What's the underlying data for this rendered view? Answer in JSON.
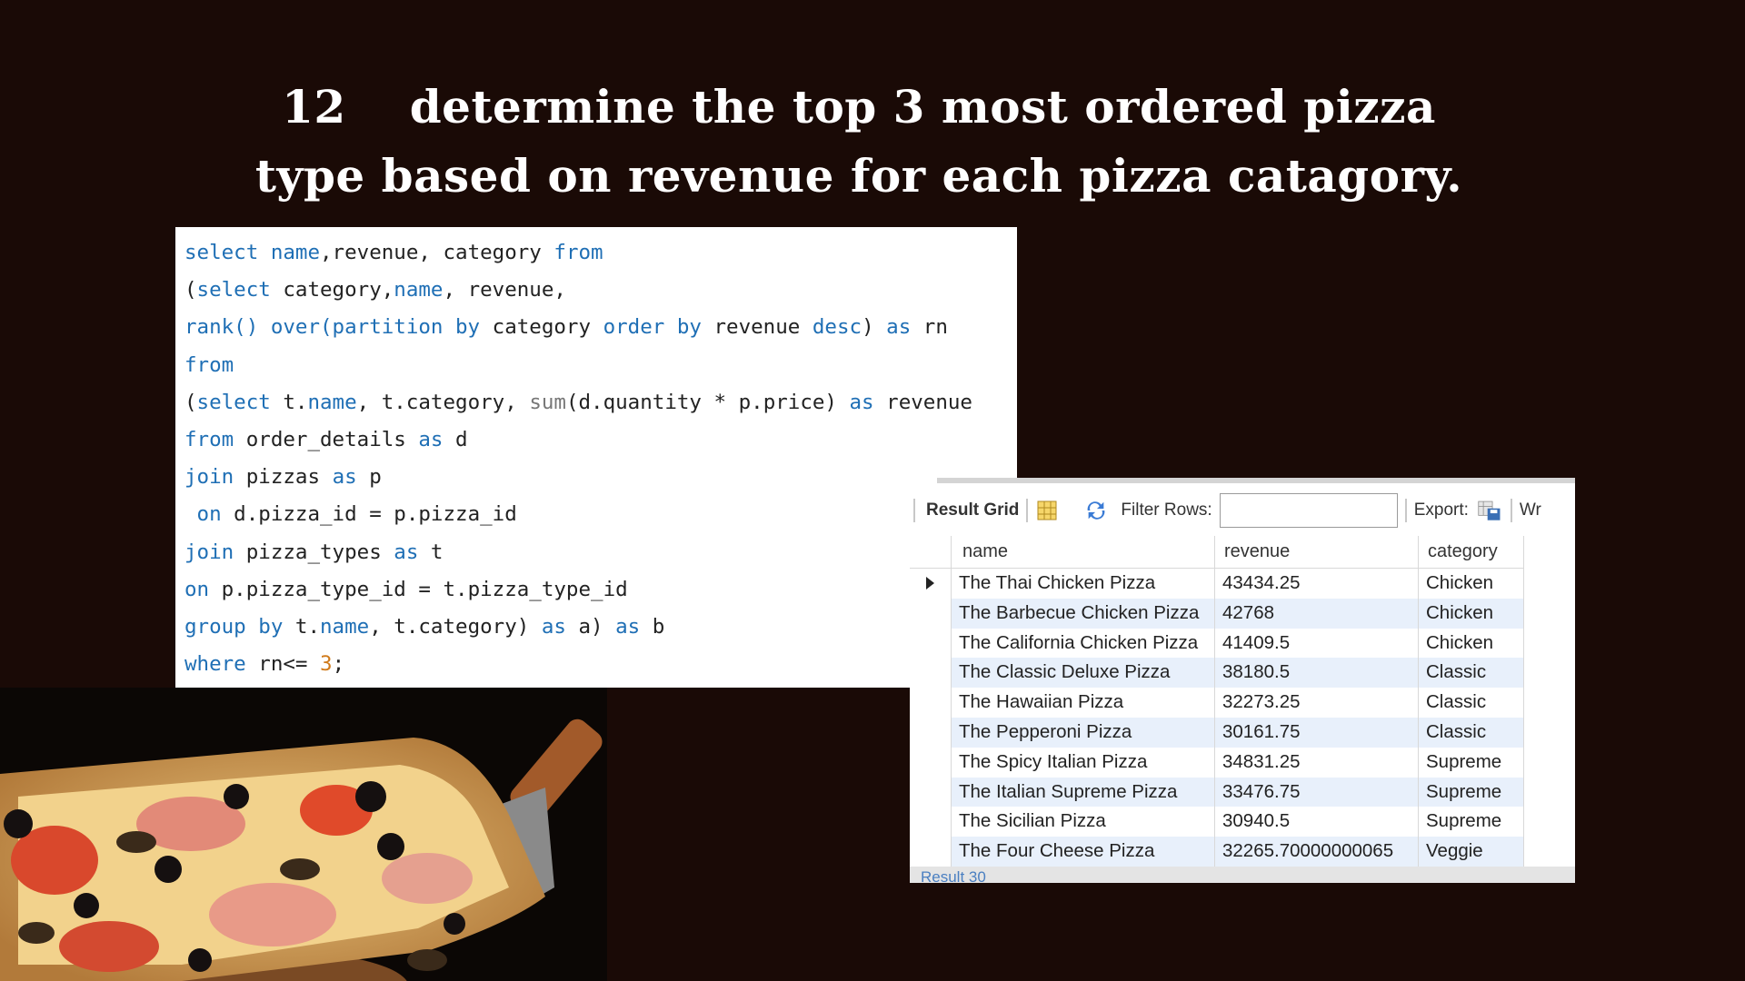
{
  "title": {
    "number": "12",
    "line1": "determine the top 3 most ordered pizza",
    "line2": "type based on revenue for each pizza catagory."
  },
  "code": [
    [
      {
        "t": "select name",
        "k": "kw"
      },
      {
        "t": ",revenue, category "
      },
      {
        "t": "from",
        "k": "kw"
      }
    ],
    [
      {
        "t": "("
      },
      {
        "t": "select",
        "k": "kw"
      },
      {
        "t": " category,"
      },
      {
        "t": "name",
        "k": "kw"
      },
      {
        "t": ", revenue,"
      }
    ],
    [
      {
        "t": "rank() over(partition by",
        "k": "kw"
      },
      {
        "t": " category "
      },
      {
        "t": "order by",
        "k": "kw"
      },
      {
        "t": " revenue "
      },
      {
        "t": "desc",
        "k": "kw"
      },
      {
        "t": ") "
      },
      {
        "t": "as",
        "k": "kw"
      },
      {
        "t": " rn"
      }
    ],
    [
      {
        "t": "from",
        "k": "kw"
      }
    ],
    [
      {
        "t": "("
      },
      {
        "t": "select",
        "k": "kw"
      },
      {
        "t": " t."
      },
      {
        "t": "name",
        "k": "kw"
      },
      {
        "t": ", t.category, "
      },
      {
        "t": "sum",
        "k": "fn"
      },
      {
        "t": "(d.quantity * p.price) "
      },
      {
        "t": "as",
        "k": "kw"
      },
      {
        "t": " revenue"
      }
    ],
    [
      {
        "t": "from",
        "k": "kw"
      },
      {
        "t": " order_details "
      },
      {
        "t": "as",
        "k": "kw"
      },
      {
        "t": " d"
      }
    ],
    [
      {
        "t": "join",
        "k": "kw"
      },
      {
        "t": " pizzas "
      },
      {
        "t": "as",
        "k": "kw"
      },
      {
        "t": " p"
      }
    ],
    [
      {
        "t": " on",
        "k": "kw"
      },
      {
        "t": " d.pizza_id = p.pizza_id"
      }
    ],
    [
      {
        "t": "join",
        "k": "kw"
      },
      {
        "t": " pizza_types "
      },
      {
        "t": "as",
        "k": "kw"
      },
      {
        "t": " t"
      }
    ],
    [
      {
        "t": "on",
        "k": "kw"
      },
      {
        "t": " p.pizza_type_id = t.pizza_type_id"
      }
    ],
    [
      {
        "t": "group by",
        "k": "kw"
      },
      {
        "t": " t."
      },
      {
        "t": "name",
        "k": "kw"
      },
      {
        "t": ", t.category) "
      },
      {
        "t": "as",
        "k": "kw"
      },
      {
        "t": " a) "
      },
      {
        "t": "as",
        "k": "kw"
      },
      {
        "t": " b"
      }
    ],
    [
      {
        "t": "where",
        "k": "kw"
      },
      {
        "t": " rn<= "
      },
      {
        "t": "3",
        "k": "n3"
      },
      {
        "t": ";"
      }
    ]
  ],
  "grid": {
    "result_grid_label": "Result Grid",
    "filter_rows_label": "Filter Rows:",
    "filter_value": "",
    "export_label": "Export:",
    "wrap_label": "Wr",
    "tab_label": "Result 30",
    "columns": [
      "name",
      "revenue",
      "category"
    ],
    "rows": [
      [
        "The Thai Chicken Pizza",
        "43434.25",
        "Chicken"
      ],
      [
        "The Barbecue Chicken Pizza",
        "42768",
        "Chicken"
      ],
      [
        "The California Chicken Pizza",
        "41409.5",
        "Chicken"
      ],
      [
        "The Classic Deluxe Pizza",
        "38180.5",
        "Classic"
      ],
      [
        "The Hawaiian Pizza",
        "32273.25",
        "Classic"
      ],
      [
        "The Pepperoni Pizza",
        "30161.75",
        "Classic"
      ],
      [
        "The Spicy Italian Pizza",
        "34831.25",
        "Supreme"
      ],
      [
        "The Italian Supreme Pizza",
        "33476.75",
        "Supreme"
      ],
      [
        "The Sicilian Pizza",
        "30940.5",
        "Supreme"
      ],
      [
        "The Four Cheese Pizza",
        "32265.70000000065",
        "Veggie"
      ]
    ]
  },
  "colors": {
    "background": "#1a0a06",
    "keyword": "#1f6fb5",
    "row_alt": "#e8f0fb"
  }
}
